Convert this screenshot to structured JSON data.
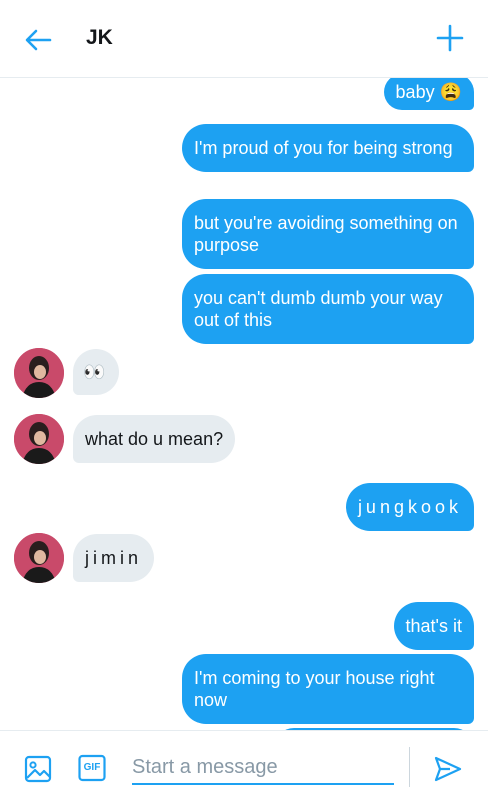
{
  "header": {
    "title": "JK"
  },
  "messages": [
    {
      "dir": "sent",
      "text": "baby 😩"
    },
    {
      "dir": "sent",
      "text": "I'm proud of you for being strong"
    },
    {
      "dir": "sent",
      "text": "but you're avoiding something on purpose"
    },
    {
      "dir": "sent",
      "text": "you can't dumb dumb your way out of this"
    },
    {
      "dir": "received",
      "text": "👀"
    },
    {
      "dir": "received",
      "text": "what do u mean?"
    },
    {
      "dir": "sent",
      "text": "jungkook"
    },
    {
      "dir": "received",
      "text": "jimin"
    },
    {
      "dir": "sent",
      "text": "that's it"
    },
    {
      "dir": "sent",
      "text": "I'm coming to your house right now"
    }
  ],
  "composer": {
    "placeholder": "Start a message",
    "gif_label": "GIF"
  },
  "colors": {
    "accent": "#1da1f2",
    "received_bubble": "#e6ecf0",
    "avatar_bg": "#c94a6a"
  },
  "icons": [
    "back-arrow-icon",
    "plus-icon",
    "image-icon",
    "gif-icon",
    "send-icon"
  ]
}
